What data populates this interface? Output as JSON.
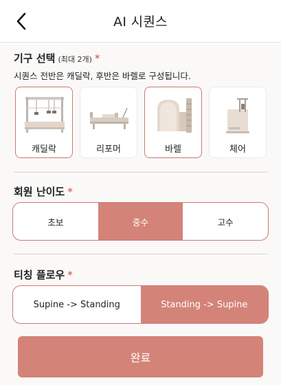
{
  "header": {
    "title": "AI 시퀀스"
  },
  "equipment": {
    "title": "기구 선택",
    "subtitle": "(최대 2개)",
    "required_mark": "*",
    "description": "시퀀스 전반은 캐딜락, 후반은 바렐로 구성됩니다.",
    "items": [
      {
        "label": "캐딜락",
        "icon": "cadillac-icon",
        "selected": true
      },
      {
        "label": "리포머",
        "icon": "reformer-icon",
        "selected": false
      },
      {
        "label": "바렐",
        "icon": "barrel-icon",
        "selected": true
      },
      {
        "label": "체어",
        "icon": "chair-icon",
        "selected": false
      }
    ]
  },
  "level": {
    "title": "회원 난이도",
    "required_mark": "*",
    "options": [
      "초보",
      "중수",
      "고수"
    ],
    "selected": "중수"
  },
  "flow": {
    "title": "티칭 플로우",
    "required_mark": "*",
    "options": [
      "Supine -> Standing",
      "Standing -> Supine"
    ],
    "selected": "Standing -> Supine"
  },
  "done_label": "완료",
  "colors": {
    "accent": "#d48379",
    "accent_border": "#cc7a70",
    "required": "#d2463f"
  }
}
